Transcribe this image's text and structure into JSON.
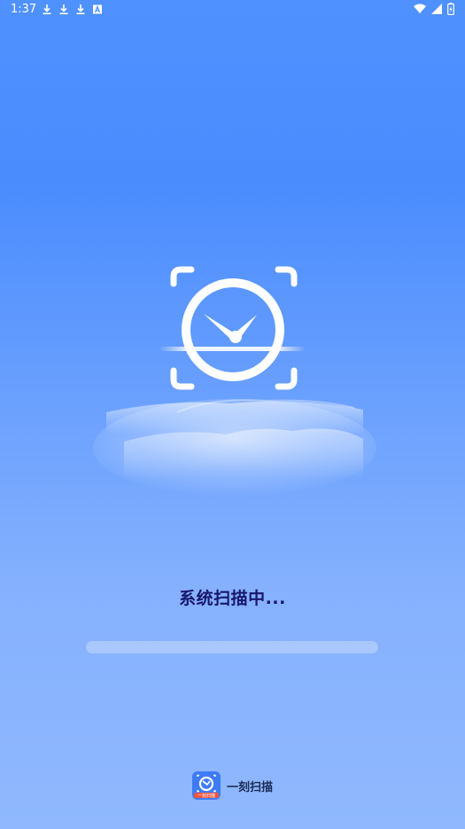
{
  "status_bar": {
    "time": "1:37",
    "notifications": [
      "download-icon",
      "download-icon",
      "download-icon",
      "font-a-icon"
    ],
    "right_icons": [
      "wifi-icon",
      "signal-icon",
      "battery-charging-icon"
    ]
  },
  "splash": {
    "illustration": "scan-clock-icon",
    "scan_text": "系统扫描中...",
    "progress": 0.0
  },
  "brand": {
    "app_icon": "app-logo-icon",
    "icon_label": "一刻扫描",
    "name": "一刻扫描"
  },
  "colors": {
    "background_top": "#4f91fe",
    "background_bottom": "#8fb8fe",
    "scan_text": "#17176b",
    "brand_text": "#1c2a55",
    "app_icon_blue": "#3e7bf7",
    "app_icon_banner": "#f2553e"
  }
}
